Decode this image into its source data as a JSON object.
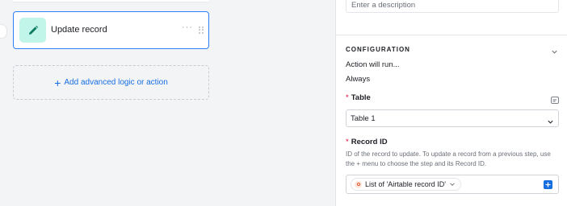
{
  "canvas": {
    "step_card": {
      "title": "Update record",
      "more_glyph": "···"
    },
    "add_action": {
      "plus_glyph": "+",
      "label": "Add advanced logic or action"
    }
  },
  "panel": {
    "description": {
      "placeholder": "Enter a description"
    },
    "configuration": {
      "title": "CONFIGURATION",
      "action_runs_label": "Action will run...",
      "action_runs_value": "Always",
      "table": {
        "required_mark": "*",
        "label": "Table",
        "value": "Table 1"
      },
      "record_id": {
        "required_mark": "*",
        "label": "Record ID",
        "help": "ID of the record to update. To update a record from a previous step, use the + menu to choose the step and its Record ID.",
        "token_label": "List of 'Airtable record ID'"
      }
    }
  },
  "colors": {
    "accent_blue": "#166ee1",
    "card_border": "#2d7ff9",
    "icon_bg": "#c2f5e9",
    "required_red": "#dc043b"
  },
  "icons": [
    "pencil-icon",
    "more-icon",
    "drag-handle-icon",
    "chevron-down-icon",
    "table-icon",
    "formula-token-icon",
    "plus-icon"
  ]
}
